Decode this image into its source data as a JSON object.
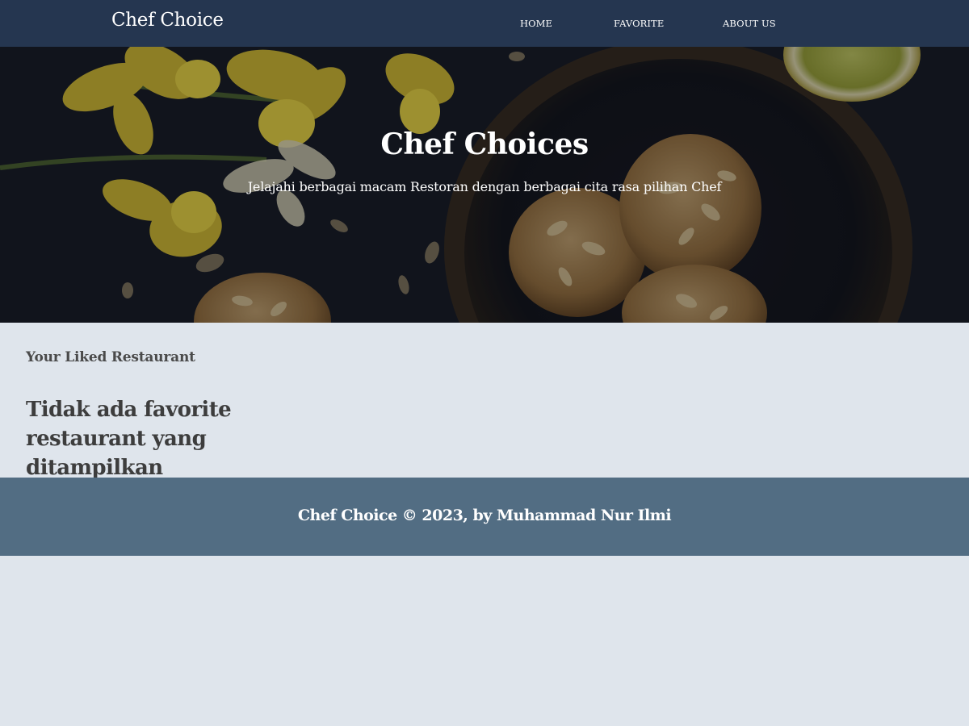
{
  "navbar": {
    "brand": "Chef Choice",
    "links": [
      {
        "label": "HOME"
      },
      {
        "label": "FAVORITE"
      },
      {
        "label": "ABOUT US"
      }
    ]
  },
  "hero": {
    "title": "Chef Choices",
    "subtitle": "Jelajahi berbagai macam Restoran dengan berbagai cita rasa pilihan Chef"
  },
  "content": {
    "section_label": "Your Liked Restaurant",
    "empty_message": "Tidak ada favorite restaurant yang ditampilkan"
  },
  "footer": {
    "text": "Chef Choice © 2023, by Muhammad Nur Ilmi"
  },
  "colors": {
    "navbar_bg": "#253650",
    "page_bg": "#dfe5ec",
    "footer_bg": "#526d83"
  }
}
